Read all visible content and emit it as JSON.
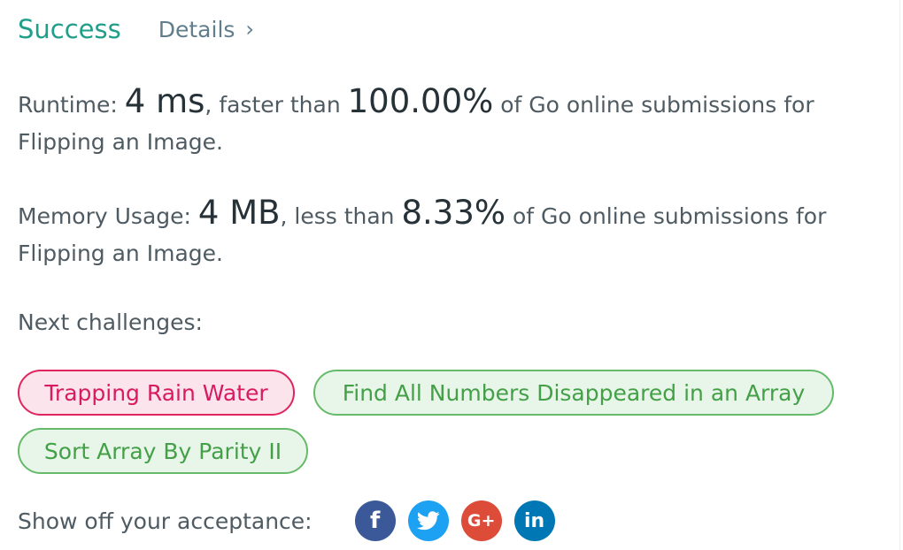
{
  "header": {
    "status": "Success",
    "details_label": "Details",
    "chevron": "›"
  },
  "runtime": {
    "label": "Runtime:",
    "value": "4 ms",
    "mid": ", faster than",
    "percent": "100.00%",
    "tail": "of Go online submissions for Flipping an Image."
  },
  "memory": {
    "label": "Memory Usage:",
    "value": "4 MB",
    "mid": ", less than",
    "percent": "8.33%",
    "tail": "of Go online submissions for Flipping an Image."
  },
  "next": {
    "label": "Next challenges:",
    "challenges": [
      {
        "title": "Trapping Rain Water",
        "difficulty_color": "#e0245e"
      },
      {
        "title": "Find All Numbers Disappeared in an Array",
        "difficulty_color": "#66bb6a"
      },
      {
        "title": "Sort Array By Parity II",
        "difficulty_color": "#66bb6a"
      }
    ]
  },
  "share": {
    "label": "Show off your acceptance:",
    "buttons": [
      {
        "icon": "facebook-icon",
        "glyph": "f",
        "color": "#3b5998"
      },
      {
        "icon": "twitter-icon",
        "glyph": "",
        "color": "#1da1f2"
      },
      {
        "icon": "google-plus-icon",
        "glyph": "G+",
        "color": "#dd4b39"
      },
      {
        "icon": "linkedin-icon",
        "glyph": "in",
        "color": "#0077b5"
      }
    ]
  }
}
